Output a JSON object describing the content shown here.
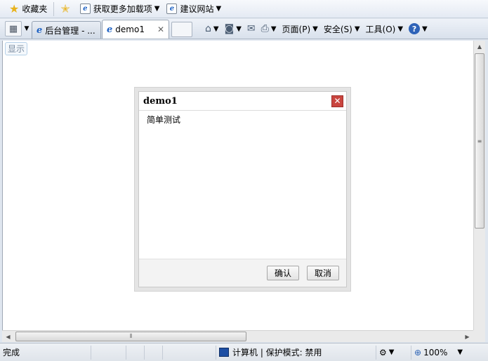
{
  "favorites_bar": {
    "favorites_label": "收藏夹",
    "items": [
      {
        "label": "获取更多加载项"
      },
      {
        "label": "建议网站"
      }
    ]
  },
  "tabs": [
    {
      "label": "后台管理 - ...",
      "active": false
    },
    {
      "label": "demo1",
      "active": true
    }
  ],
  "command_bar": {
    "page": "页面(P)",
    "safety": "安全(S)",
    "tools": "工具(O)",
    "help_glyph": "?"
  },
  "page": {
    "show_button": "显示"
  },
  "dialog": {
    "title": "demo1",
    "close_glyph": "✕",
    "body": "简单测试",
    "confirm": "确认",
    "cancel": "取消"
  },
  "status_bar": {
    "status": "完成",
    "zone": "计算机 | 保护模式: 禁用",
    "zoom": "100%"
  },
  "colors": {
    "dialog_close": "#c9453f",
    "zone_icon": "#1d4fa4",
    "help_icon": "#2e63b8"
  },
  "icons": [
    "star-icon",
    "ie-page-icon",
    "quick-tabs-icon",
    "home-icon",
    "rss-icon",
    "mail-icon",
    "print-icon",
    "help-icon",
    "close-icon",
    "computer-zone-icon",
    "zoom-icon"
  ]
}
